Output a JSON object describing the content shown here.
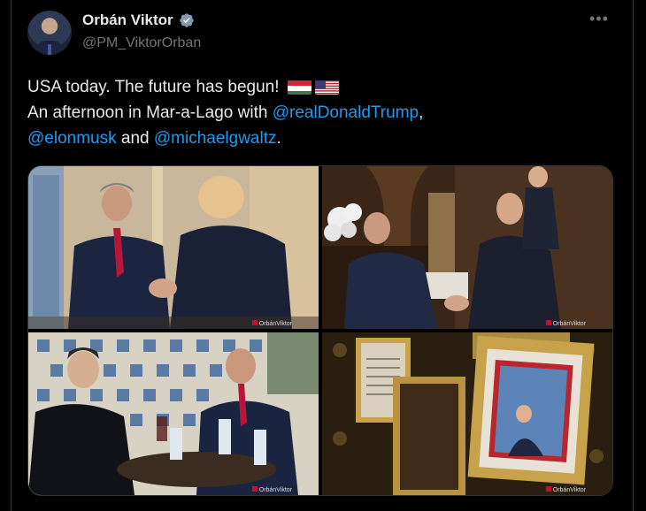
{
  "author": {
    "name": "Orbán Viktor",
    "handle": "@PM_ViktorOrban"
  },
  "post": {
    "line1": "USA today. The future has begun!",
    "line2_prefix": "An afternoon in Mar-a-Lago with ",
    "mention_trump": "@realDonaldTrump",
    "comma": ",",
    "mention_musk": "@elonmusk",
    "and": " and ",
    "mention_waltz": "@michaelgwaltz",
    "period": ".",
    "flags": [
      "hungary-flag-icon",
      "usa-flag-icon"
    ]
  },
  "more_icon": "more-horizontal-icon",
  "watermark": "OrbánViktor",
  "colors": {
    "background": "#000000",
    "text": "#e7e9ea",
    "secondary": "#71767b",
    "link": "#1d9bf0",
    "verified": "#829aab"
  }
}
